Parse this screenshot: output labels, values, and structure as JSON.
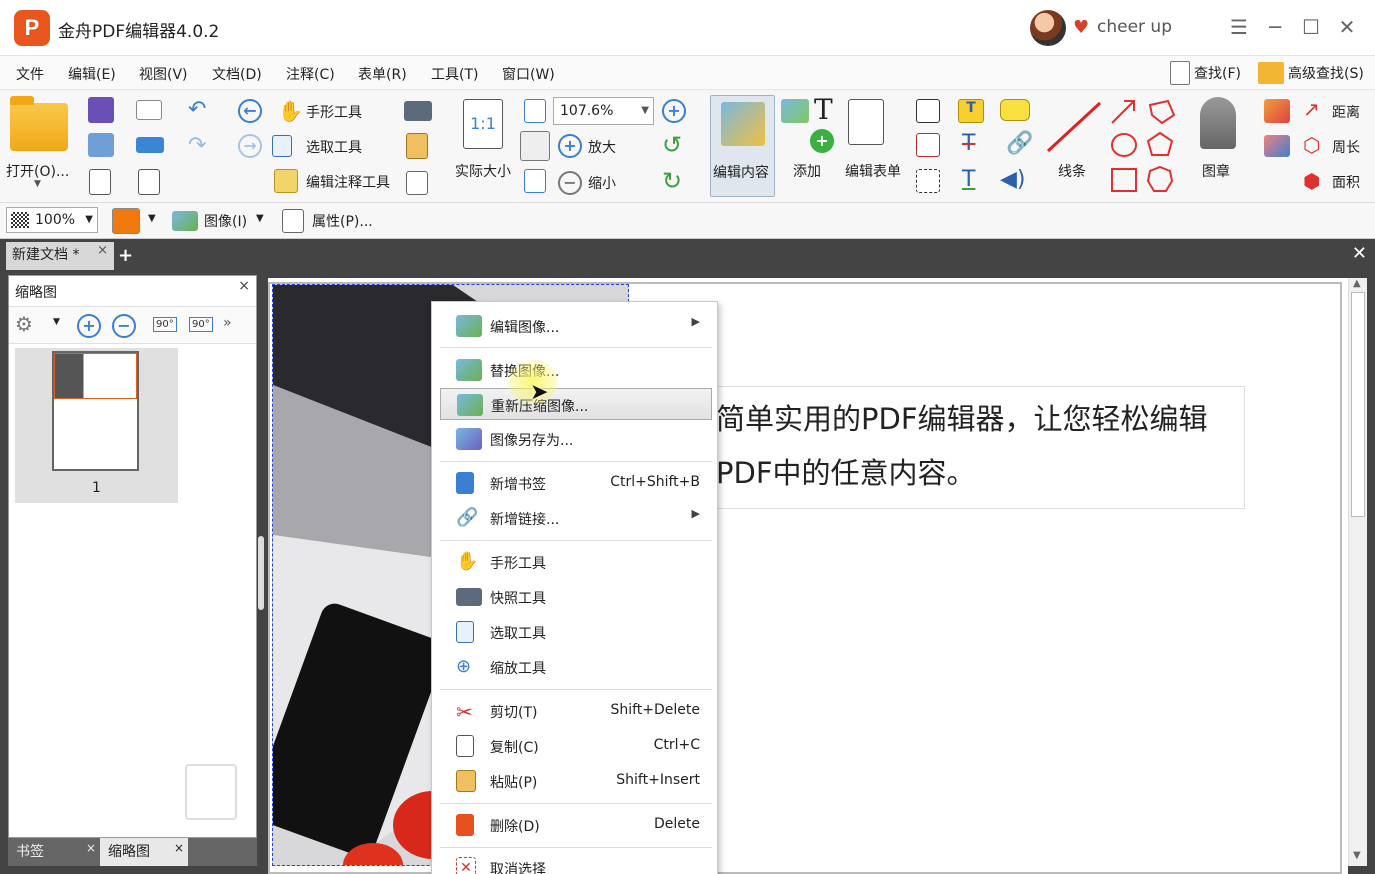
{
  "title_bar": {
    "logo_letter": "P",
    "app_title": "金舟PDF编辑器4.0.2",
    "username": "cheer up",
    "menu_glyph": "☰",
    "minimize_glyph": "─",
    "maximize_glyph": "☐",
    "close_glyph": "✕"
  },
  "menubar": {
    "items": [
      "文件",
      "编辑(E)",
      "视图(V)",
      "文档(D)",
      "注释(C)",
      "表单(R)",
      "工具(T)",
      "窗口(W)"
    ],
    "find": "查找(F)",
    "advanced_find": "高级查找(S)"
  },
  "ribbon": {
    "open": "打开(O)...",
    "hand_tool": "手形工具",
    "select_tool": "选取工具",
    "edit_annotation_tool": "编辑注释工具",
    "actual_size": "实际大小",
    "actual_size_icon_text": "1:1",
    "zoom_value": "107.6%",
    "zoom_in": "放大",
    "zoom_out": "缩小",
    "edit_content": "编辑内容",
    "add": "添加",
    "edit_form": "编辑表单",
    "line": "线条",
    "stamp": "图章",
    "distance": "距离",
    "perimeter": "周长",
    "area": "面积"
  },
  "ribbon2": {
    "opacity": "100%",
    "image_menu": "图像(I)",
    "properties": "属性(P)..."
  },
  "tabs": {
    "doc_tab": "新建文档 *",
    "close_glyph": "×",
    "add_glyph": "+",
    "close_all_glyph": "✕"
  },
  "side_panel": {
    "title": "缩略图",
    "close_glyph": "×",
    "rotate_left": "90°",
    "rotate_right": "90°",
    "page_number": "1",
    "bottom_tabs": [
      "书签",
      "缩略图"
    ]
  },
  "document": {
    "text": "简单实用的PDF编辑器，让您轻松编辑PDF中的任意内容。"
  },
  "context_menu": {
    "items": [
      {
        "label": "编辑图像...",
        "shortcut": "",
        "submenu": true
      },
      {
        "label": "替换图像...",
        "shortcut": "",
        "submenu": false
      },
      {
        "label": "重新压缩图像...",
        "shortcut": "",
        "submenu": false
      },
      {
        "label": "图像另存为...",
        "shortcut": "",
        "submenu": false
      },
      {
        "label": "新增书签",
        "shortcut": "Ctrl+Shift+B",
        "submenu": false
      },
      {
        "label": "新增链接...",
        "shortcut": "",
        "submenu": true
      },
      {
        "label": "手形工具",
        "shortcut": "",
        "submenu": false
      },
      {
        "label": "快照工具",
        "shortcut": "",
        "submenu": false
      },
      {
        "label": "选取工具",
        "shortcut": "",
        "submenu": false
      },
      {
        "label": "缩放工具",
        "shortcut": "",
        "submenu": false
      },
      {
        "label": "剪切(T)",
        "shortcut": "Shift+Delete",
        "submenu": false
      },
      {
        "label": "复制(C)",
        "shortcut": "Ctrl+C",
        "submenu": false
      },
      {
        "label": "粘贴(P)",
        "shortcut": "Shift+Insert",
        "submenu": false
      },
      {
        "label": "删除(D)",
        "shortcut": "Delete",
        "submenu": false
      },
      {
        "label": "取消选择",
        "shortcut": "",
        "submenu": false
      }
    ],
    "submenu_glyph": "▶",
    "hovered_index": 2
  },
  "colors": {
    "accent_orange": "#e8551e",
    "fill_color": "#f07a10",
    "menu_hover_border": "#aaaaaa"
  }
}
